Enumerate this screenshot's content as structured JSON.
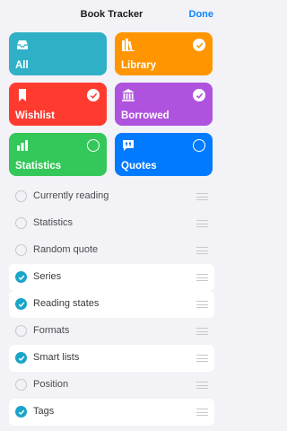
{
  "header": {
    "title": "Book Tracker",
    "done_label": "Done"
  },
  "tiles": [
    {
      "label": "All",
      "color": "#30b0c7",
      "icon": "tray-icon",
      "selected": null
    },
    {
      "label": "Library",
      "color": "#ff9500",
      "icon": "books-icon",
      "selected": true
    },
    {
      "label": "Wishlist",
      "color": "#ff3b30",
      "icon": "bookmark-icon",
      "selected": true
    },
    {
      "label": "Borrowed",
      "color": "#af52de",
      "icon": "building-columns-icon",
      "selected": true
    },
    {
      "label": "Statistics",
      "color": "#34c759",
      "icon": "bar-chart-icon",
      "selected": false
    },
    {
      "label": "Quotes",
      "color": "#007aff",
      "icon": "quote-bubble-icon",
      "selected": false
    }
  ],
  "rows": [
    {
      "label": "Currently reading",
      "checked": false
    },
    {
      "label": "Statistics",
      "checked": false
    },
    {
      "label": "Random quote",
      "checked": false
    },
    {
      "label": "Series",
      "checked": true
    },
    {
      "label": "Reading states",
      "checked": true
    },
    {
      "label": "Formats",
      "checked": false
    },
    {
      "label": "Smart lists",
      "checked": true
    },
    {
      "label": "Position",
      "checked": false
    },
    {
      "label": "Tags",
      "checked": true
    }
  ],
  "colors": {
    "accent": "#0a84ff",
    "check_fill": "#1aa5c8",
    "background": "#f2f2f7"
  }
}
